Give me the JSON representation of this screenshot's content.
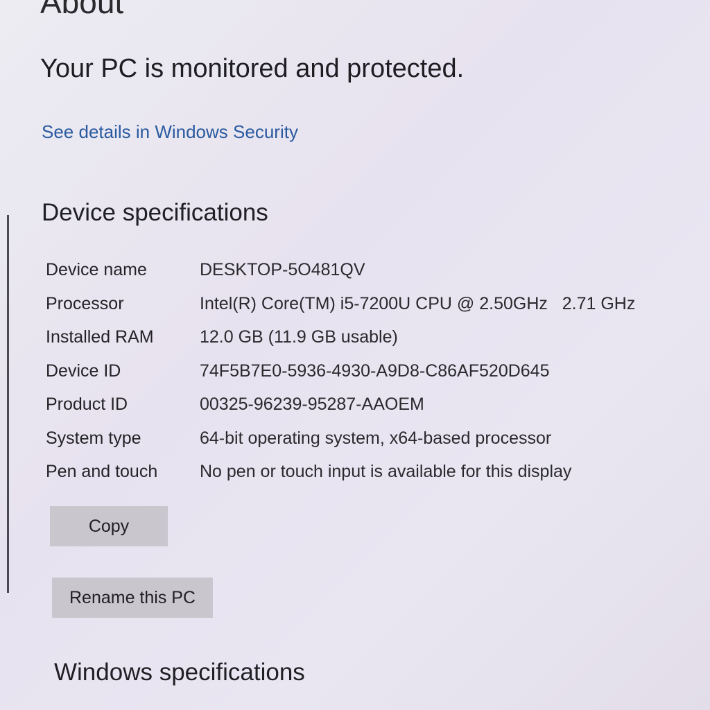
{
  "page": {
    "title": "About"
  },
  "security": {
    "status": "Your PC is monitored and protected.",
    "link_label": "See details in Windows Security"
  },
  "device_specs": {
    "heading": "Device specifications",
    "rows": [
      {
        "label": "Device name",
        "value": "DESKTOP-5O481QV"
      },
      {
        "label": "Processor",
        "value": "Intel(R) Core(TM) i5-7200U CPU @ 2.50GHz   2.71 GHz"
      },
      {
        "label": "Installed RAM",
        "value": "12.0 GB (11.9 GB usable)"
      },
      {
        "label": "Device ID",
        "value": "74F5B7E0-5936-4930-A9D8-C86AF520D645"
      },
      {
        "label": "Product ID",
        "value": "00325-96239-95287-AAOEM"
      },
      {
        "label": "System type",
        "value": "64-bit operating system, x64-based processor"
      },
      {
        "label": "Pen and touch",
        "value": "No pen or touch input is available for this display"
      }
    ],
    "copy_label": "Copy",
    "rename_label": "Rename this PC"
  },
  "windows_specs": {
    "heading": "Windows specifications"
  }
}
